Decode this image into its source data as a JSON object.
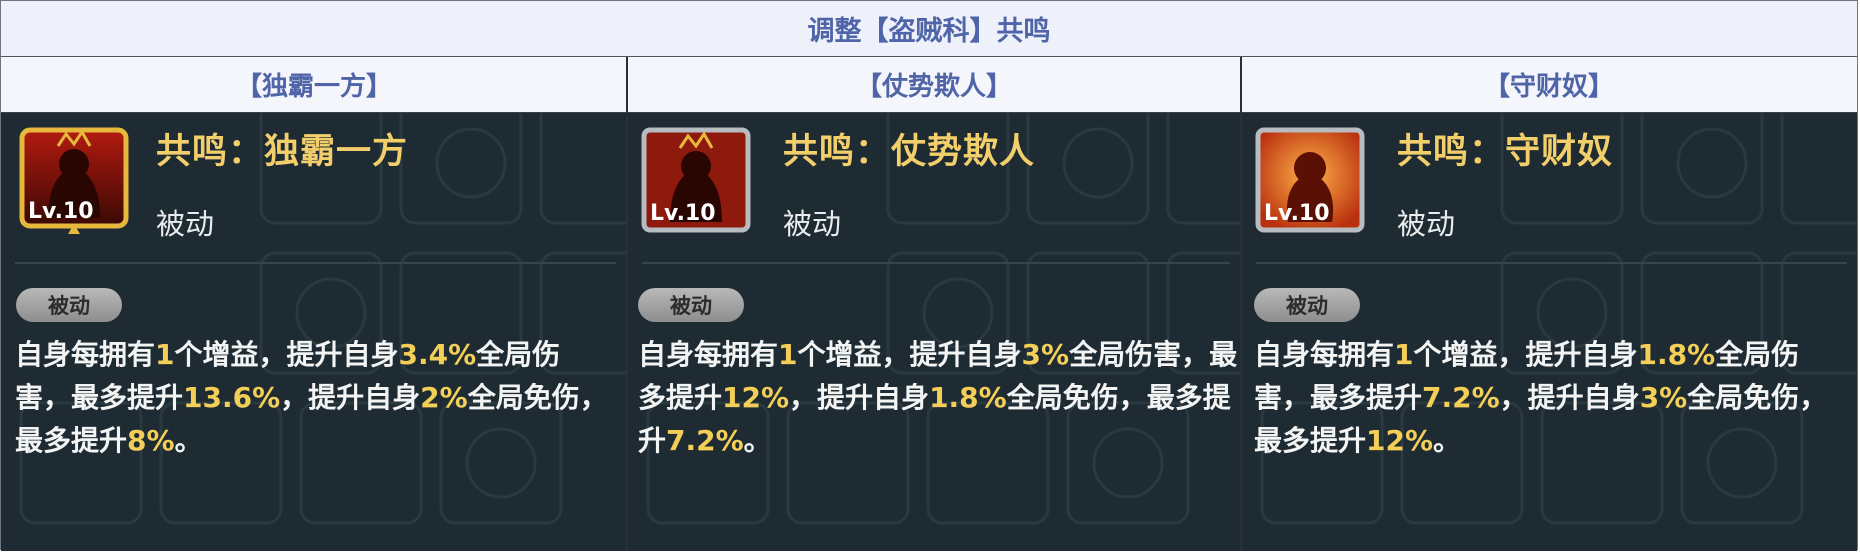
{
  "title": "调整【盗贼科】共鸣",
  "columns": [
    {
      "header": "【独霸一方】",
      "skill_name": "共鸣：独霸一方",
      "skill_type": "被动",
      "level": "Lv.10",
      "badge": "被动",
      "desc": [
        {
          "t": "自身每拥有"
        },
        {
          "t": "1",
          "hl": true
        },
        {
          "t": "个增益，提升自身"
        },
        {
          "t": "3.4%",
          "hl": true
        },
        {
          "t": "全局伤害，最多提升"
        },
        {
          "t": "13.6%",
          "hl": true
        },
        {
          "t": "，提升自身"
        },
        {
          "t": "2%",
          "hl": true
        },
        {
          "t": "全局免伤，最多提升"
        },
        {
          "t": "8%",
          "hl": true
        },
        {
          "t": "。"
        }
      ],
      "icon": "fire-silhouette-icon-gold-frame"
    },
    {
      "header": "【仗势欺人】",
      "skill_name": "共鸣：仗势欺人",
      "skill_type": "被动",
      "level": "Lv.10",
      "badge": "被动",
      "desc": [
        {
          "t": "自身每拥有"
        },
        {
          "t": "1",
          "hl": true
        },
        {
          "t": "个增益，提升自身"
        },
        {
          "t": "3%",
          "hl": true
        },
        {
          "t": "全局伤害，最多提升"
        },
        {
          "t": "12%",
          "hl": true
        },
        {
          "t": "，提升自身"
        },
        {
          "t": "1.8%",
          "hl": true
        },
        {
          "t": "全局免伤，最多提升"
        },
        {
          "t": "7.2%",
          "hl": true
        },
        {
          "t": "。"
        }
      ],
      "icon": "fire-silhouette-icon-silver-frame"
    },
    {
      "header": "【守财奴】",
      "skill_name": "共鸣：守财奴",
      "skill_type": "被动",
      "level": "Lv.10",
      "badge": "被动",
      "desc": [
        {
          "t": "自身每拥有"
        },
        {
          "t": "1",
          "hl": true
        },
        {
          "t": "个增益，提升自身"
        },
        {
          "t": "1.8%",
          "hl": true
        },
        {
          "t": "全局伤害，最多提升"
        },
        {
          "t": "7.2%",
          "hl": true
        },
        {
          "t": "，提升自身"
        },
        {
          "t": "3%",
          "hl": true
        },
        {
          "t": "全局免伤，最多提升"
        },
        {
          "t": "12%",
          "hl": true
        },
        {
          "t": "。"
        }
      ],
      "icon": "orange-burst-silhouette-icon"
    }
  ],
  "colors": {
    "header_text": "#4f65a8",
    "panel_bg": "#1f2b33",
    "skill_name": "#f2cf6a",
    "highlight": "#f3cf58"
  }
}
